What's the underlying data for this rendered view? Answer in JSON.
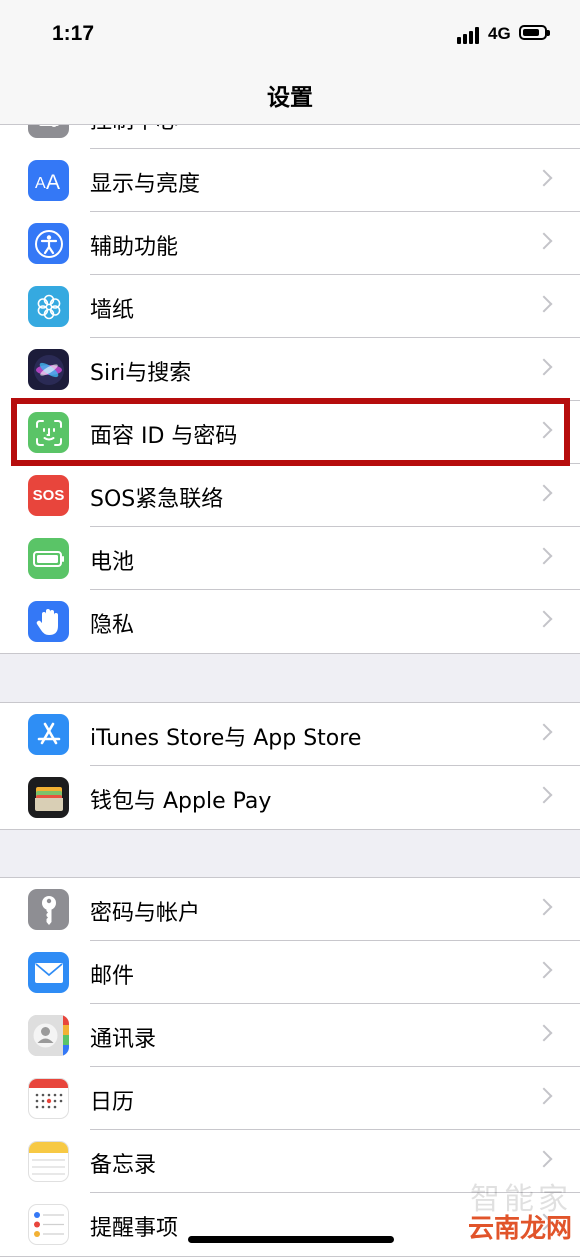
{
  "status_bar": {
    "time": "1:17",
    "network": "4G"
  },
  "nav": {
    "title": "设置"
  },
  "groups": [
    {
      "items": [
        {
          "label": "控制中心",
          "icon": "control-center-icon",
          "color": "#8e8e93"
        },
        {
          "label": "显示与亮度",
          "icon": "display-brightness-icon",
          "color": "#3478f6"
        },
        {
          "label": "辅助功能",
          "icon": "accessibility-icon",
          "color": "#3478f6"
        },
        {
          "label": "墙纸",
          "icon": "wallpaper-icon",
          "color": "#35a9e0"
        },
        {
          "label": "Siri与搜索",
          "icon": "siri-icon",
          "color": "#1c1c3a"
        },
        {
          "label": "面容 ID 与密码",
          "icon": "face-id-icon",
          "color": "#5ac467"
        },
        {
          "label": "SOS紧急联络",
          "icon": "sos-icon",
          "color": "#e8453c"
        },
        {
          "label": "电池",
          "icon": "battery-icon",
          "color": "#5ac467"
        },
        {
          "label": "隐私",
          "icon": "privacy-hand-icon",
          "color": "#3478f6"
        }
      ]
    },
    {
      "items": [
        {
          "label": "iTunes Store与 App Store",
          "icon": "app-store-icon",
          "color": "#2e8ef5"
        },
        {
          "label": "钱包与 Apple Pay",
          "icon": "wallet-icon",
          "color": "#1c1c1e"
        }
      ]
    },
    {
      "items": [
        {
          "label": "密码与帐户",
          "icon": "key-icon",
          "color": "#8e8e93"
        },
        {
          "label": "邮件",
          "icon": "mail-icon",
          "color": "#2f8cf5"
        },
        {
          "label": "通讯录",
          "icon": "contacts-icon",
          "color": "#d8d8d8"
        },
        {
          "label": "日历",
          "icon": "calendar-icon",
          "color": "#ffffff"
        },
        {
          "label": "备忘录",
          "icon": "notes-icon",
          "color": "#ffffff"
        },
        {
          "label": "提醒事项",
          "icon": "reminders-icon",
          "color": "#ffffff"
        }
      ]
    }
  ],
  "watermark": {
    "top": "智能家",
    "bottom": "云南龙网"
  },
  "highlight_color": "#b60d0d"
}
